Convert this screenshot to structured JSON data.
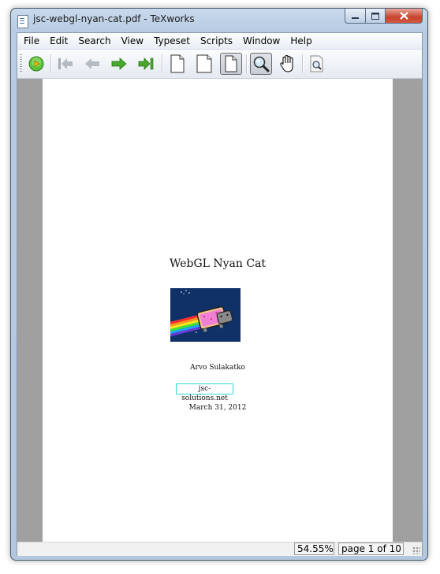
{
  "window": {
    "title": "jsc-webgl-nyan-cat.pdf - TeXworks",
    "controls": {
      "minimize": "minimize-icon",
      "maximize": "maximize-icon",
      "close": "close-icon"
    }
  },
  "menu": [
    "File",
    "Edit",
    "Search",
    "View",
    "Typeset",
    "Scripts",
    "Window",
    "Help"
  ],
  "toolbar": {
    "typeset": "typeset-play-icon",
    "first_page": "first-page-icon",
    "previous_page": "previous-page-icon",
    "next_page": "next-page-icon",
    "last_page": "last-page-icon",
    "actual_size": "actual-size-page-icon",
    "fit_width": "fit-width-page-icon",
    "fit_window": "fit-window-page-icon",
    "magnify": "magnifier-icon",
    "scroll_hand": "hand-scroll-icon",
    "find": "find-in-pdf-icon"
  },
  "document": {
    "title": "WebGL Nyan Cat",
    "author": "Arvo Sulakatko",
    "link": "jsc-solutions.net",
    "date": "March 31, 2012"
  },
  "status": {
    "zoom": "54.55%",
    "page": "page 1 of 10"
  },
  "colors": {
    "accent_blue": "#b7cbe2",
    "link_box": "#34d8d8",
    "nav_green": "#47a82c",
    "viewport_gray": "#a0a0a0"
  }
}
